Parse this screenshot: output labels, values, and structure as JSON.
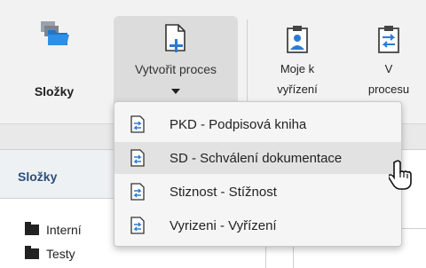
{
  "ribbon": {
    "folders_label": "Složky",
    "create_label": "Vytvořit proces",
    "mine_label_1": "Moje k",
    "mine_label_2": "vyřízení",
    "process_label_1": "V",
    "process_label_2": "procesu"
  },
  "left_panel": {
    "title": "Složky",
    "folders": [
      "Interní",
      "Testy"
    ]
  },
  "dropdown": {
    "items": [
      "PKD - Podpisová kniha",
      "SD - Schválení dokumentace",
      "Stiznost - Stížnost",
      "Vyrizeni - Vyřízení"
    ],
    "hovered_index": 1
  },
  "icons": {
    "folders": "folders-icon",
    "create": "new-document-plus-icon",
    "mine": "clipboard-user-icon",
    "process": "clipboard-arrows-icon",
    "item": "document-arrows-icon",
    "cursor": "hand-pointer-icon"
  },
  "colors": {
    "accent": "#2a4f7a",
    "icon_blue": "#2b7bd6"
  }
}
